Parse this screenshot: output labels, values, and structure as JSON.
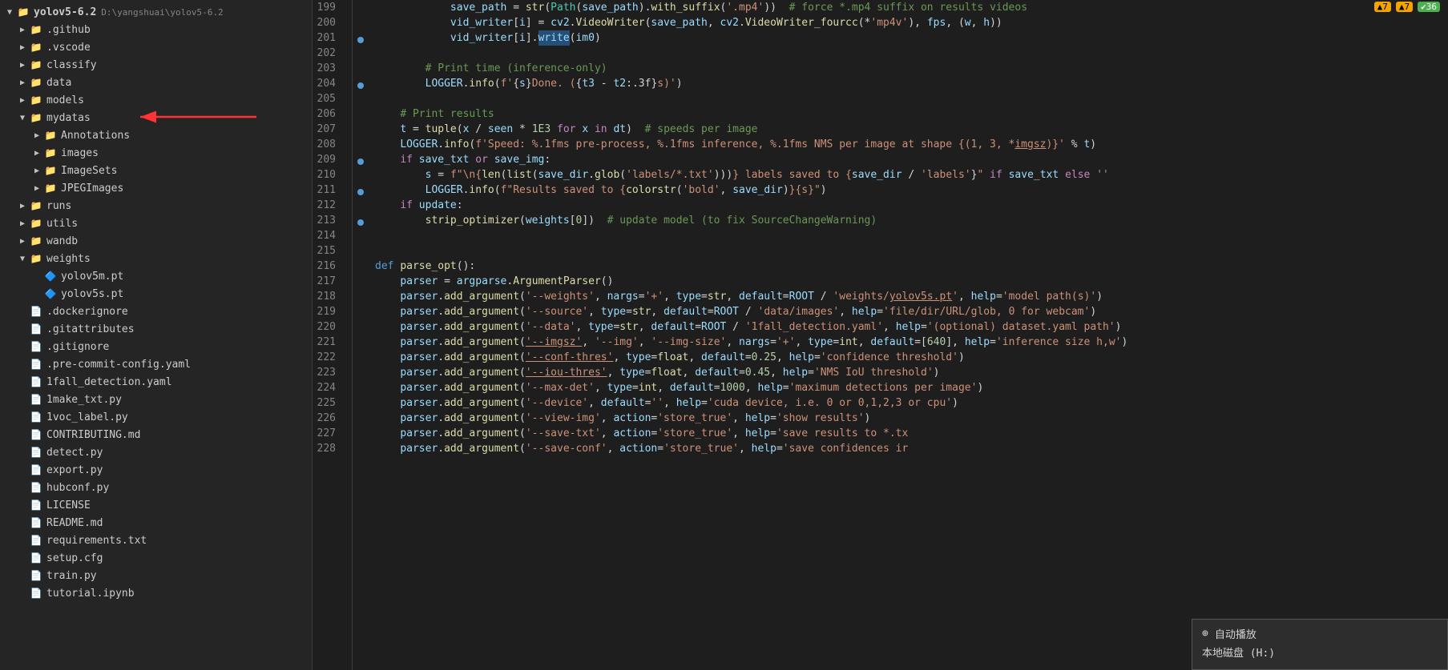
{
  "sidebar": {
    "root": "yolov5-6.2",
    "rootPath": "D:\\yangshuai\\yolov5-6.2",
    "items": [
      {
        "id": "github",
        "label": ".github",
        "type": "folder",
        "level": 1,
        "expanded": false,
        "arrow": "▶"
      },
      {
        "id": "vscode",
        "label": ".vscode",
        "type": "folder",
        "level": 1,
        "expanded": false,
        "arrow": "▶"
      },
      {
        "id": "classify",
        "label": "classify",
        "type": "folder",
        "level": 1,
        "expanded": false,
        "arrow": "▶"
      },
      {
        "id": "data",
        "label": "data",
        "type": "folder",
        "level": 1,
        "expanded": false,
        "arrow": "▶"
      },
      {
        "id": "models",
        "label": "models",
        "type": "folder",
        "level": 1,
        "expanded": false,
        "arrow": "▶"
      },
      {
        "id": "mydatas",
        "label": "mydatas",
        "type": "folder",
        "level": 1,
        "expanded": true,
        "arrow": "▼",
        "hasRedArrow": true
      },
      {
        "id": "Annotations",
        "label": "Annotations",
        "type": "folder",
        "level": 2,
        "expanded": false,
        "arrow": "▶"
      },
      {
        "id": "images",
        "label": "images",
        "type": "folder",
        "level": 2,
        "expanded": false,
        "arrow": "▶"
      },
      {
        "id": "ImageSets",
        "label": "ImageSets",
        "type": "folder",
        "level": 2,
        "expanded": false,
        "arrow": "▶"
      },
      {
        "id": "JPEGImages",
        "label": "JPEGImages",
        "type": "folder",
        "level": 2,
        "expanded": false,
        "arrow": "▶"
      },
      {
        "id": "runs",
        "label": "runs",
        "type": "folder",
        "level": 1,
        "expanded": false,
        "arrow": "▶"
      },
      {
        "id": "utils",
        "label": "utils",
        "type": "folder",
        "level": 1,
        "expanded": false,
        "arrow": "▶"
      },
      {
        "id": "wandb",
        "label": "wandb",
        "type": "folder",
        "level": 1,
        "expanded": false,
        "arrow": "▶"
      },
      {
        "id": "weights",
        "label": "weights",
        "type": "folder",
        "level": 1,
        "expanded": true,
        "arrow": "▼"
      },
      {
        "id": "yolov5m_pt",
        "label": "yolov5m.pt",
        "type": "file-pt",
        "level": 2,
        "arrow": ""
      },
      {
        "id": "yolov5s_pt",
        "label": "yolov5s.pt",
        "type": "file-pt",
        "level": 2,
        "arrow": ""
      },
      {
        "id": "dockerignore",
        "label": ".dockerignore",
        "type": "file",
        "level": 1,
        "arrow": ""
      },
      {
        "id": "gitattributes",
        "label": ".gitattributes",
        "type": "file",
        "level": 1,
        "arrow": ""
      },
      {
        "id": "gitignore",
        "label": ".gitignore",
        "type": "file",
        "level": 1,
        "arrow": ""
      },
      {
        "id": "precommit",
        "label": ".pre-commit-config.yaml",
        "type": "file-yaml",
        "level": 1,
        "arrow": ""
      },
      {
        "id": "falldetection",
        "label": "1fall_detection.yaml",
        "type": "file-yaml",
        "level": 1,
        "arrow": ""
      },
      {
        "id": "maketxt",
        "label": "1make_txt.py",
        "type": "file-py",
        "level": 1,
        "arrow": ""
      },
      {
        "id": "voclabel",
        "label": "1voc_label.py",
        "type": "file-py",
        "level": 1,
        "arrow": ""
      },
      {
        "id": "contributing",
        "label": "CONTRIBUTING.md",
        "type": "file-md",
        "level": 1,
        "arrow": ""
      },
      {
        "id": "detect",
        "label": "detect.py",
        "type": "file-py",
        "level": 1,
        "arrow": ""
      },
      {
        "id": "export",
        "label": "export.py",
        "type": "file-py",
        "level": 1,
        "arrow": ""
      },
      {
        "id": "hubconf",
        "label": "hubconf.py",
        "type": "file-py",
        "level": 1,
        "arrow": ""
      },
      {
        "id": "license",
        "label": "LICENSE",
        "type": "file",
        "level": 1,
        "arrow": ""
      },
      {
        "id": "readme",
        "label": "README.md",
        "type": "file-md",
        "level": 1,
        "arrow": ""
      },
      {
        "id": "requirements",
        "label": "requirements.txt",
        "type": "file-txt",
        "level": 1,
        "arrow": ""
      },
      {
        "id": "setup",
        "label": "setup.cfg",
        "type": "file",
        "level": 1,
        "arrow": ""
      },
      {
        "id": "train",
        "label": "train.py",
        "type": "file-py",
        "level": 1,
        "arrow": ""
      },
      {
        "id": "tutorial",
        "label": "tutorial.ipynb",
        "type": "file-ipynb",
        "level": 1,
        "arrow": ""
      }
    ]
  },
  "statusIcons": {
    "warnings": "▲7",
    "errors": "▲7",
    "ok": "✔36"
  },
  "editor": {
    "lines": [
      {
        "num": 199,
        "hasGutter": false,
        "content": "            save_path = str(Path(save_path).with_suffix('.mp4'))  # force *.mp4 suffix on results videos"
      },
      {
        "num": 200,
        "hasGutter": false,
        "content": "            vid_writer[i] = cv2.VideoWriter(save_path, cv2.VideoWriter_fourcc(*'mp4v'), fps, (w, h))"
      },
      {
        "num": 201,
        "hasGutter": true,
        "content": "            vid_writer[i].write(im0)"
      },
      {
        "num": 202,
        "hasGutter": false,
        "content": ""
      },
      {
        "num": 203,
        "hasGutter": false,
        "content": "        # Print time (inference-only)"
      },
      {
        "num": 204,
        "hasGutter": true,
        "content": "        LOGGER.info(f'{s}Done. ({t3 - t2:.3f}s)')"
      },
      {
        "num": 205,
        "hasGutter": false,
        "content": ""
      },
      {
        "num": 206,
        "hasGutter": false,
        "content": "    # Print results"
      },
      {
        "num": 207,
        "hasGutter": false,
        "content": "    t = tuple(x / seen * 1E3 for x in dt)  # speeds per image"
      },
      {
        "num": 208,
        "hasGutter": false,
        "content": "    LOGGER.info(f'Speed: %.1fms pre-process, %.1fms inference, %.1fms NMS per image at shape {(1, 3, *imgsz)}' % t)"
      },
      {
        "num": 209,
        "hasGutter": true,
        "content": "    if save_txt or save_img:"
      },
      {
        "num": 210,
        "hasGutter": false,
        "content": "        s = f\"\\n{len(list(save_dir.glob('labels/*.txt')))} labels saved to {save_dir / 'labels'}\" if save_txt else ''"
      },
      {
        "num": 211,
        "hasGutter": true,
        "content": "        LOGGER.info(f\"Results saved to {colorstr('bold', save_dir)}{s}\")"
      },
      {
        "num": 212,
        "hasGutter": false,
        "content": "    if update:"
      },
      {
        "num": 213,
        "hasGutter": true,
        "content": "        strip_optimizer(weights[0])  # update model (to fix SourceChangeWarning)"
      },
      {
        "num": 214,
        "hasGutter": false,
        "content": ""
      },
      {
        "num": 215,
        "hasGutter": false,
        "content": ""
      },
      {
        "num": 216,
        "hasGutter": false,
        "content": "def parse_opt():"
      },
      {
        "num": 217,
        "hasGutter": false,
        "content": "    parser = argparse.ArgumentParser()"
      },
      {
        "num": 218,
        "hasGutter": false,
        "content": "    parser.add_argument('--weights', nargs='+', type=str, default=ROOT / 'weights/yolov5s.pt', help='model path(s)')"
      },
      {
        "num": 219,
        "hasGutter": false,
        "content": "    parser.add_argument('--source', type=str, default=ROOT / 'data/images', help='file/dir/URL/glob, 0 for webcam')"
      },
      {
        "num": 220,
        "hasGutter": false,
        "content": "    parser.add_argument('--data', type=str, default=ROOT / '1fall_detection.yaml', help='(optional) dataset.yaml path')"
      },
      {
        "num": 221,
        "hasGutter": false,
        "content": "    parser.add_argument('--imgsz', '--img', '--img-size', nargs='+', type=int, default=[640], help='inference size h,w')"
      },
      {
        "num": 222,
        "hasGutter": false,
        "content": "    parser.add_argument('--conf-thres', type=float, default=0.25, help='confidence threshold')"
      },
      {
        "num": 223,
        "hasGutter": false,
        "content": "    parser.add_argument('--iou-thres', type=float, default=0.45, help='NMS IoU threshold')"
      },
      {
        "num": 224,
        "hasGutter": false,
        "content": "    parser.add_argument('--max-det', type=int, default=1000, help='maximum detections per image')"
      },
      {
        "num": 225,
        "hasGutter": false,
        "content": "    parser.add_argument('--device', default='', help='cuda device, i.e. 0 or 0,1,2,3 or cpu')"
      },
      {
        "num": 226,
        "hasGutter": false,
        "content": "    parser.add_argument('--view-img', action='store_true', help='show results')"
      },
      {
        "num": 227,
        "hasGutter": false,
        "content": "    parser.add_argument('--save-txt', action='store_true', help='save results to *.tx"
      },
      {
        "num": 228,
        "hasGutter": false,
        "content": "    parser.add_argument('--save-conf', action='store_true', help='save confidences ir"
      }
    ]
  },
  "tooltip": {
    "icon": "⊕",
    "line1": "自动播放",
    "line2": "本地磁盘 (H:)"
  }
}
